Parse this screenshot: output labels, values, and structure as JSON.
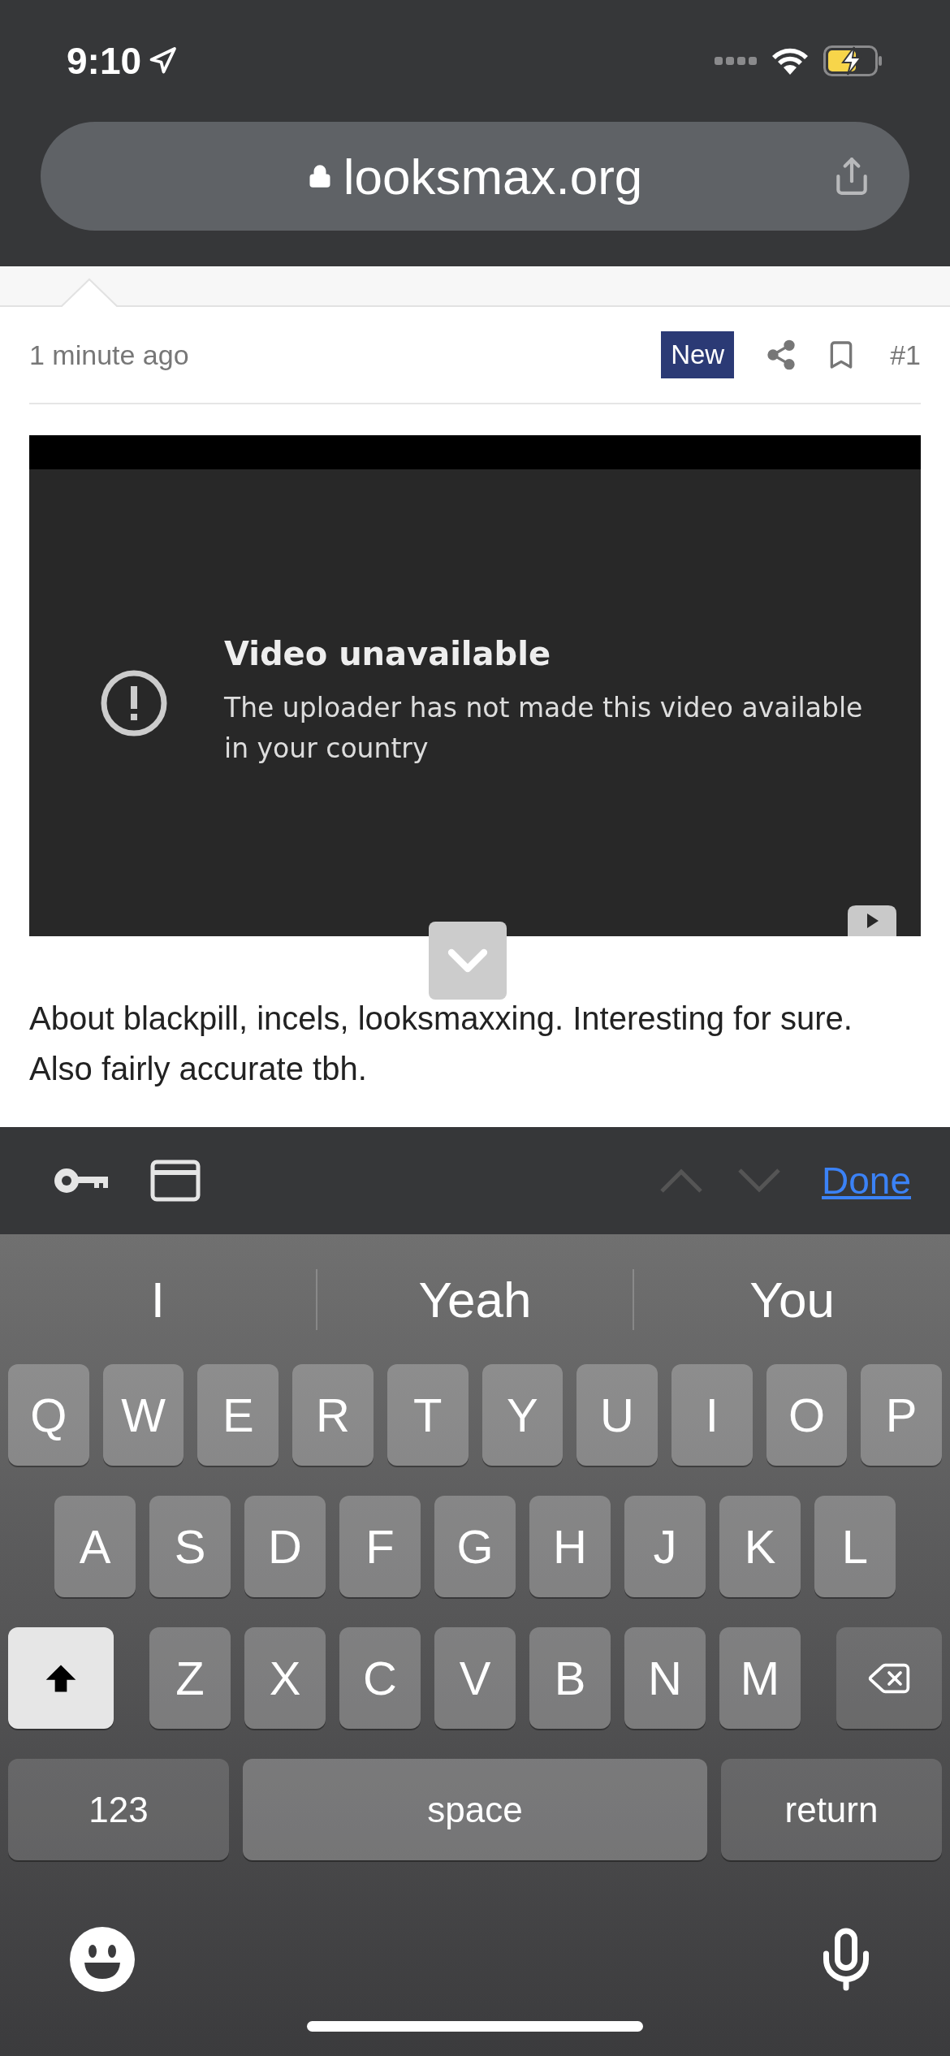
{
  "status_bar": {
    "time": "9:10"
  },
  "browser": {
    "url": "looksmax.org"
  },
  "post": {
    "time": "1 minute ago",
    "badge": "New",
    "number": "#1",
    "video": {
      "title": "Video unavailable",
      "message": "The uploader has not made this video available in your country"
    },
    "text": "About blackpill, incels, looksmaxxing. Interesting for sure. Also fairly accurate tbh."
  },
  "accessory_bar": {
    "previous_disabled": true,
    "next_disabled": true,
    "done": "Done"
  },
  "suggestions": [
    "I",
    "Yeah",
    "You"
  ],
  "keyboard": {
    "rows": [
      {
        "keys": [
          {
            "kind": "letter",
            "label": "Q"
          },
          {
            "kind": "letter",
            "label": "W"
          },
          {
            "kind": "letter",
            "label": "E"
          },
          {
            "kind": "letter",
            "label": "R"
          },
          {
            "kind": "letter",
            "label": "T"
          },
          {
            "kind": "letter",
            "label": "Y"
          },
          {
            "kind": "letter",
            "label": "U"
          },
          {
            "kind": "letter",
            "label": "I"
          },
          {
            "kind": "letter",
            "label": "O"
          },
          {
            "kind": "letter",
            "label": "P"
          }
        ]
      },
      {
        "keys": [
          {
            "kind": "letter",
            "label": "A"
          },
          {
            "kind": "letter",
            "label": "S"
          },
          {
            "kind": "letter",
            "label": "D"
          },
          {
            "kind": "letter",
            "label": "F"
          },
          {
            "kind": "letter",
            "label": "G"
          },
          {
            "kind": "letter",
            "label": "H"
          },
          {
            "kind": "letter",
            "label": "J"
          },
          {
            "kind": "letter",
            "label": "K"
          },
          {
            "kind": "letter",
            "label": "L"
          }
        ]
      },
      {
        "keys": [
          {
            "kind": "shift",
            "on": true
          },
          {
            "kind": "letter",
            "label": "Z"
          },
          {
            "kind": "letter",
            "label": "X"
          },
          {
            "kind": "letter",
            "label": "C"
          },
          {
            "kind": "letter",
            "label": "V"
          },
          {
            "kind": "letter",
            "label": "B"
          },
          {
            "kind": "letter",
            "label": "N"
          },
          {
            "kind": "letter",
            "label": "M"
          },
          {
            "kind": "delete"
          }
        ]
      },
      {
        "keys": [
          {
            "kind": "mode",
            "label": "123"
          },
          {
            "kind": "space",
            "label": "space"
          },
          {
            "kind": "return",
            "label": "return"
          }
        ]
      }
    ]
  }
}
